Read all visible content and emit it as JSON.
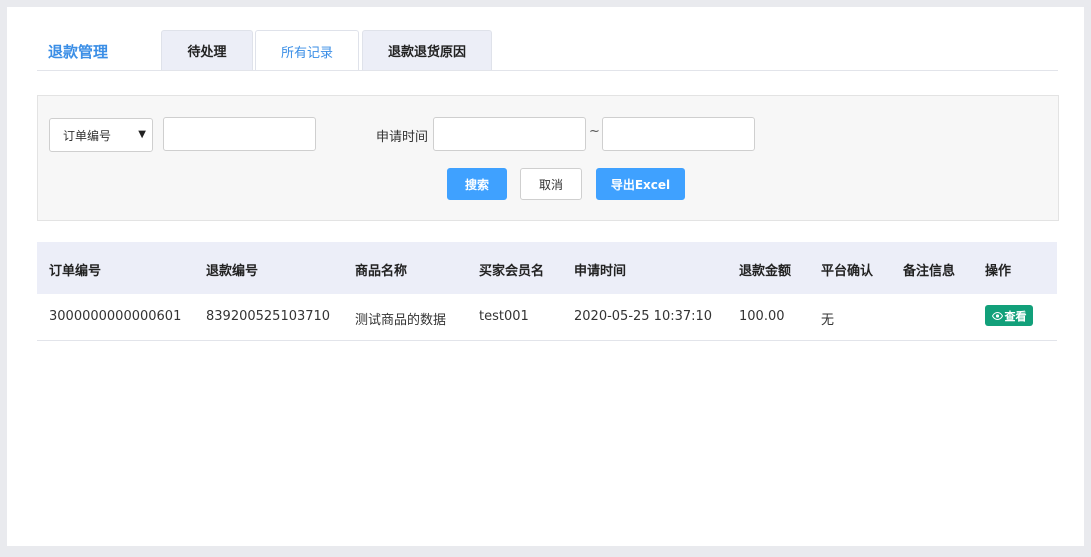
{
  "page": {
    "title": "退款管理"
  },
  "tabs": [
    {
      "label": "待处理",
      "active": false
    },
    {
      "label": "所有记录",
      "active": true
    },
    {
      "label": "退款退货原因",
      "active": false
    }
  ],
  "filter": {
    "field_select": {
      "selected": "订单编号"
    },
    "keyword_value": "",
    "date_label": "申请时间",
    "date_separator": "~",
    "start_date_value": "",
    "end_date_value": "",
    "search_label": "搜索",
    "cancel_label": "取消",
    "export_label": "导出Excel"
  },
  "table": {
    "columns": [
      "订单编号",
      "退款编号",
      "商品名称",
      "买家会员名",
      "申请时间",
      "退款金额",
      "平台确认",
      "备注信息",
      "操作"
    ],
    "rows": [
      {
        "order_no": "3000000000000601",
        "refund_no": "839200525103710",
        "product_name": "测试商品的数据",
        "buyer": "test001",
        "apply_time": "2020-05-25 10:37:10",
        "amount": "100.00",
        "platform_confirm": "无",
        "remark": "",
        "action_label": "查看"
      }
    ]
  },
  "colors": {
    "accent": "#3a8ee6",
    "primary_button": "#3fa1ff",
    "view_button": "#12a07a"
  },
  "icons": {
    "view_button_icon": "eye-icon",
    "select_caret": "caret-down-icon"
  }
}
